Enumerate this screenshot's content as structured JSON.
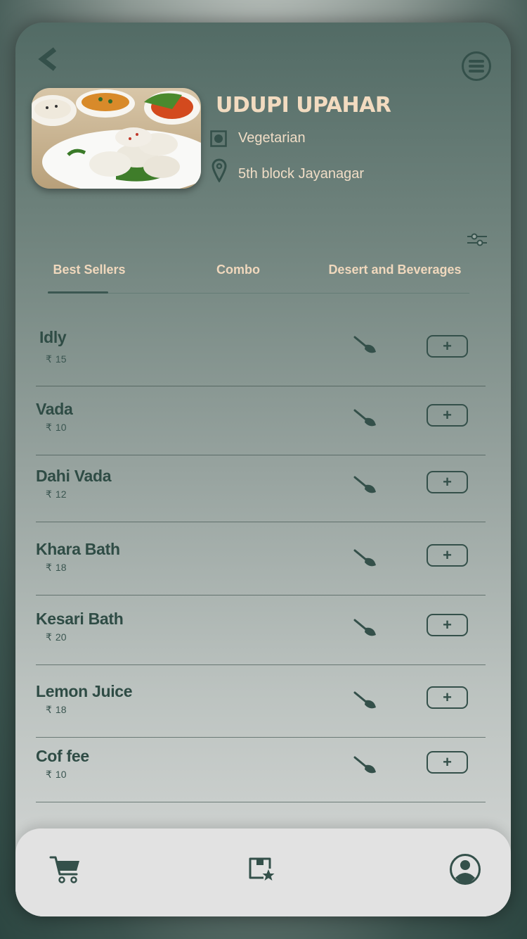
{
  "header": {
    "back_icon": "back-chevron-icon",
    "menu_icon": "menu-icon"
  },
  "restaurant": {
    "name": "UDUPI UPAHAR",
    "type": "Vegetarian",
    "location": "5th block Jayanagar",
    "image": "idli-sambar-photo"
  },
  "tabs": [
    {
      "label": "Best Sellers",
      "active": true
    },
    {
      "label": "Combo",
      "active": false
    },
    {
      "label": "Desert and Beverages",
      "active": false
    }
  ],
  "menu_items": [
    {
      "name": "Idly",
      "price": "15"
    },
    {
      "name": "Vada",
      "price": "10"
    },
    {
      "name": "Dahi Vada",
      "price": "12"
    },
    {
      "name": "Khara Bath",
      "price": "18"
    },
    {
      "name": "Kesari Bath",
      "price": "20"
    },
    {
      "name": "Lemon Juice",
      "price": "18"
    },
    {
      "name": "Cof fee",
      "price": "10"
    }
  ],
  "currency_symbol": "₹",
  "add_label": "+",
  "bottom_nav": [
    "cart-icon",
    "saved-items-icon",
    "profile-icon"
  ],
  "colors": {
    "accent_text": "#f2dbc0",
    "dark_green": "#2f4c45",
    "bottom_bar": "#e2e2e2"
  }
}
